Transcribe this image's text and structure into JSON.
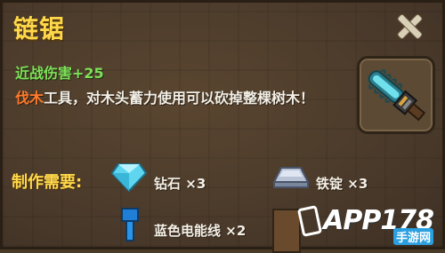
{
  "item": {
    "name": "链锯",
    "stat": "近战伤害+25",
    "desc_highlight": "伐木",
    "desc_rest": "工具，对木头蓄力使用可以砍掉整棵树木！",
    "icon": "chainsaw-icon"
  },
  "recipe": {
    "label": "制作需要:",
    "materials": [
      {
        "name": "钻石",
        "qty": "×3",
        "icon": "diamond-icon"
      },
      {
        "name": "铁锭",
        "qty": "×3",
        "icon": "iron-ingot-icon"
      },
      {
        "name": "蓝色电能线",
        "qty": "×2",
        "icon": "blue-wire-icon"
      }
    ]
  },
  "watermark": {
    "text": "APP178",
    "sub": "手游网"
  },
  "colors": {
    "title": "#ffd84a",
    "stat": "#7fe05a",
    "highlight": "#ff7a2a"
  }
}
